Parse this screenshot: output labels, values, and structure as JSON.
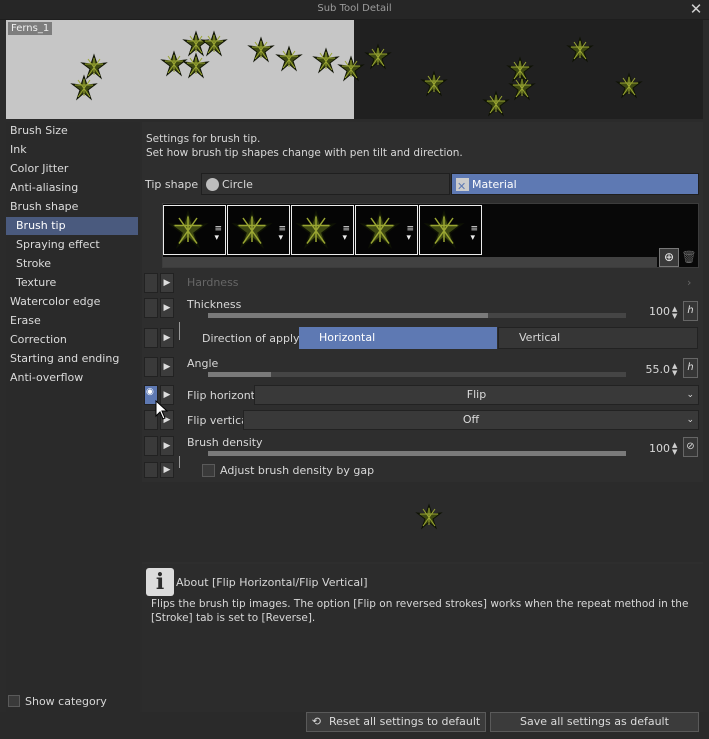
{
  "window": {
    "title": "Sub Tool Detail",
    "close_icon": "close-icon"
  },
  "preview": {
    "name": "Ferns_1"
  },
  "sidebar": {
    "items": [
      {
        "label": "Brush Size"
      },
      {
        "label": "Ink"
      },
      {
        "label": "Color Jitter"
      },
      {
        "label": "Anti-aliasing"
      },
      {
        "label": "Brush shape"
      },
      {
        "label": "Brush tip",
        "selected": true
      },
      {
        "label": "Spraying effect"
      },
      {
        "label": "Stroke"
      },
      {
        "label": "Texture"
      },
      {
        "label": "Watercolor edge"
      },
      {
        "label": "Erase"
      },
      {
        "label": "Correction"
      },
      {
        "label": "Starting and ending"
      },
      {
        "label": "Anti-overflow"
      }
    ],
    "show_category": "Show category"
  },
  "main": {
    "desc_line1": "Settings for brush tip.",
    "desc_line2": "Set how brush tip shapes change with pen tilt and direction.",
    "tip_shape_label": "Tip shape",
    "tip_circle": "Circle",
    "tip_material": "Material",
    "tip_count": 5
  },
  "params": {
    "hardness": {
      "label": "Hardness"
    },
    "thickness": {
      "label": "Thickness",
      "value": "100",
      "fill": 0.67
    },
    "direction": {
      "label": "Direction of applying",
      "horizontal": "Horizontal",
      "vertical": "Vertical"
    },
    "angle": {
      "label": "Angle",
      "value": "55.0",
      "fill": 0.15
    },
    "flip_h": {
      "label": "Flip horizontal",
      "value": "Flip"
    },
    "flip_v": {
      "label": "Flip vertical",
      "value": "Off"
    },
    "density": {
      "label": "Brush density",
      "value": "100",
      "fill": 1.0
    },
    "adjust_density": {
      "label": "Adjust brush density by gap",
      "checked": false
    }
  },
  "about": {
    "title": "About [Flip Horizontal/Flip Vertical]",
    "body": "Flips the brush tip images. The option [Flip on reversed strokes] works when the repeat method in the [Stroke] tab is set to [Reverse]."
  },
  "footer": {
    "reset": "Reset all settings to default",
    "save": "Save all settings as default"
  },
  "colors": {
    "accent": "#5e79b3",
    "selected": "#4a5a7e"
  }
}
